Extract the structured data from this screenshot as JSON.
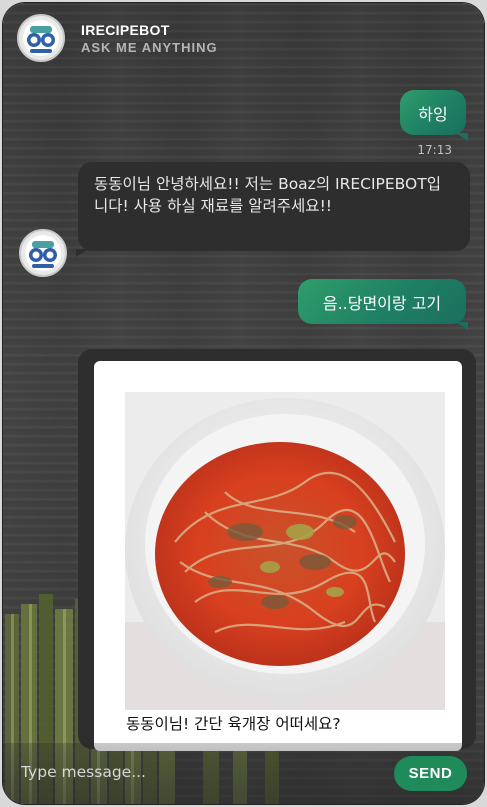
{
  "header": {
    "bot_name": "IRECIPEBOT",
    "subtitle": "ASK ME ANYTHING",
    "avatar_icon": "robot-face-icon"
  },
  "messages": {
    "user_1": {
      "text": "하잉",
      "time": "17:13"
    },
    "bot_1": {
      "text": "동동이님 안녕하세요!! 저는 Boaz의 IRECIPEBOT입니다! 사용 하실 재료를 알려주세요!!"
    },
    "user_2": {
      "text": "음..당면이랑 고기"
    },
    "bot_card": {
      "caption": "동동이님! 간단 육개장 어떠세요?",
      "image_subject": "육개장 with glass noodles in white bowl"
    }
  },
  "composer": {
    "placeholder": "Type message...",
    "send_label": "SEND"
  },
  "colors": {
    "user_bubble": "#1f8064",
    "bot_bubble": "#2e2e2e",
    "send_button": "#1f8a5a",
    "background": "#3e3e3e"
  }
}
